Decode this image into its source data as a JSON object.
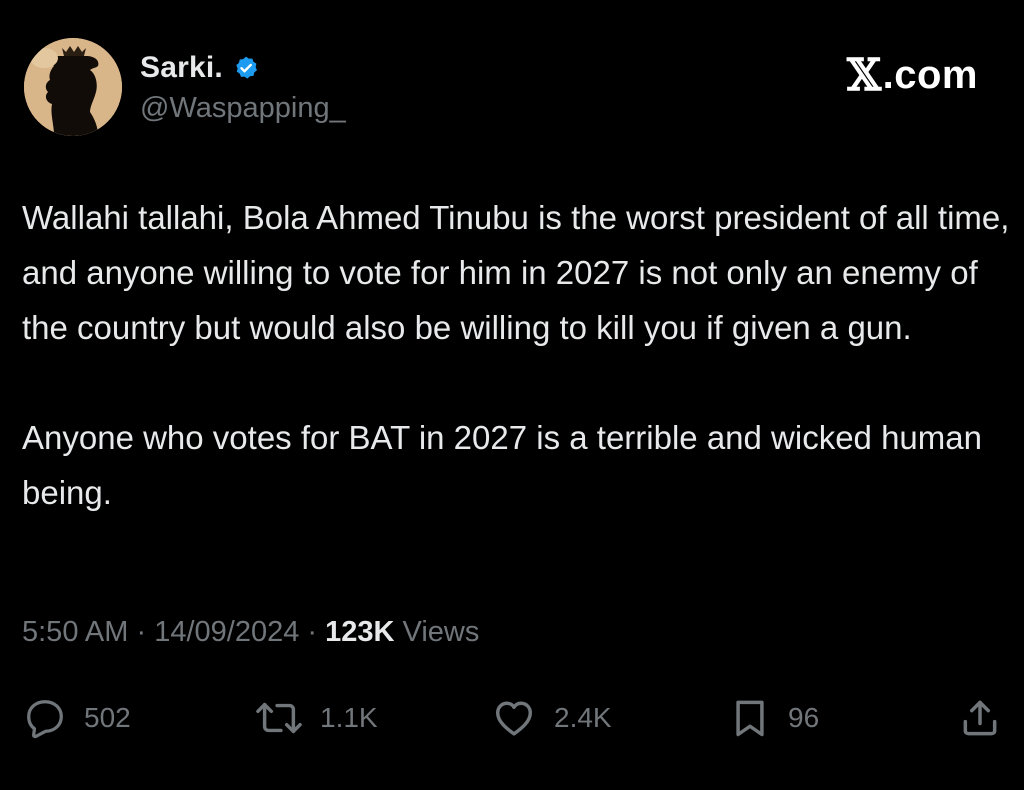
{
  "header": {
    "display_name": "Sarki.",
    "handle": "@Waspapping_",
    "brand": "X.com",
    "brand_x": "𝕏",
    "brand_suffix": ".com"
  },
  "tweet": {
    "paragraphs": [
      "Wallahi tallahi, Bola Ahmed Tinubu is the worst president of all time, and anyone willing to vote for him in 2027 is not only an enemy of the country but would also be willing to kill you if given a gun.",
      "Anyone who votes for BAT in 2027 is a terrible and wicked human being."
    ]
  },
  "meta": {
    "time": "5:50 AM",
    "separator": " · ",
    "date": "14/09/2024",
    "views_count": "123K",
    "views_label": " Views"
  },
  "actions": {
    "replies": "502",
    "reposts": "1.1K",
    "likes": "2.4K",
    "bookmarks": "96"
  },
  "icons": {
    "verified": "verified-badge-icon",
    "reply": "reply-icon",
    "repost": "repost-icon",
    "like": "heart-icon",
    "bookmark": "bookmark-icon",
    "share": "share-icon"
  },
  "colors": {
    "background": "#000000",
    "text_primary": "#e7e9ea",
    "text_secondary": "#71767b",
    "verified": "#1d9bf0",
    "avatar_bg": "#d9b58a"
  }
}
